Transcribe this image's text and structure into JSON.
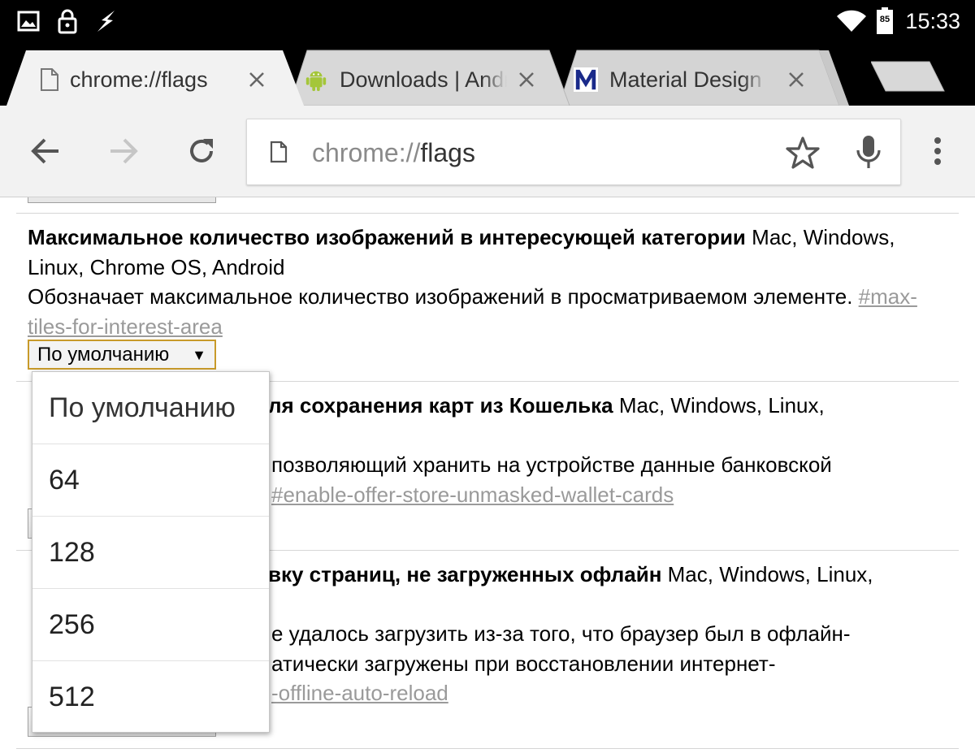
{
  "status_bar": {
    "time": "15:33",
    "battery_level": "85",
    "icons": [
      "image-notification-icon",
      "lock-notification-icon",
      "flash-notification-icon",
      "wifi-icon",
      "battery-icon"
    ]
  },
  "tabs": [
    {
      "title": "chrome://flags",
      "favicon": "page-icon",
      "active": true
    },
    {
      "title": "Downloads | Android",
      "favicon": "android-icon",
      "active": false
    },
    {
      "title": "Material Design Icons",
      "favicon": "material-m-icon",
      "active": false
    }
  ],
  "toolbar": {
    "url_scheme": "chrome://",
    "url_host": "flags",
    "icons": [
      "back-arrow-icon",
      "forward-arrow-icon",
      "reload-icon",
      "page-icon",
      "star-icon",
      "microphone-icon",
      "overflow-menu-icon"
    ]
  },
  "experiments": [
    {
      "title": "Максимальное количество изображений в интересующей категории",
      "platforms": "Mac, Windows, Linux, Chrome OS, Android",
      "description": "Обозначает максимальное количество изображений в просматриваемом элементе.",
      "link": "#max-tiles-for-interest-area",
      "select_value": "По умолчанию"
    },
    {
      "title_visible": "ля сохранения карт из Кошелька",
      "platforms_visible": "Mac, Windows, Linux,",
      "description_line1": "позволяющий хранить на устройстве данные банковской",
      "link_visible": "#enable-offer-store-unmasked-wallet-cards"
    },
    {
      "title_visible": "вку страниц, не загруженных офлайн",
      "platforms_visible": "Mac, Windows, Linux,",
      "description_line1": "е удалось загрузить из-за того, что браузер был в офлайн-",
      "description_line2": "атически загружены при восстановлении интернет-",
      "link_visible": "-offline-auto-reload"
    }
  ],
  "dropdown": {
    "options": [
      "По умолчанию",
      "64",
      "128",
      "256",
      "512"
    ],
    "selected": "По умолчанию"
  },
  "colors": {
    "status_bar_bg": "#000000",
    "toolbar_bg": "#f2f2f2",
    "active_tab_bg": "#f2f2f2",
    "inactive_tab_bg": "#d4d4d4",
    "link_color": "#9a9a9a",
    "select_focus_border": "#c89a2a",
    "android_green": "#a4c639",
    "material_m_blue": "#1a2a8a"
  }
}
